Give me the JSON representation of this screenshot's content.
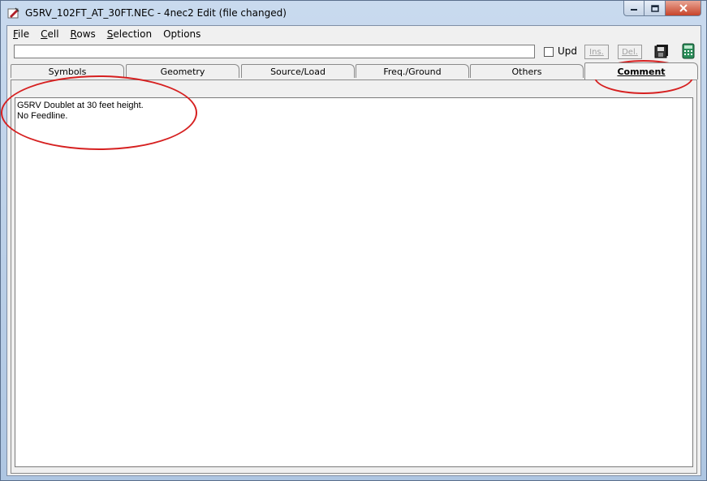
{
  "window": {
    "title": "G5RV_102FT_AT_30FT.NEC - 4nec2 Edit (file changed)",
    "accent_color": "#c7442a"
  },
  "menu": [
    {
      "id": "file",
      "label": "File",
      "accel": "F",
      "rest": "ile"
    },
    {
      "id": "cell",
      "label": "Cell",
      "accel": "C",
      "rest": "ell"
    },
    {
      "id": "rows",
      "label": "Rows",
      "accel": "R",
      "rest": "ows"
    },
    {
      "id": "selection",
      "label": "Selection",
      "accel": "S",
      "rest": "election"
    },
    {
      "id": "options",
      "label": "Options",
      "accel": "",
      "rest": "Options"
    }
  ],
  "toolbar": {
    "input_value": "",
    "upd_label": "Upd",
    "ins_label": "Ins.",
    "del_label": "Del.",
    "save_icon": "save-disk-icon",
    "calc_icon": "calculator-icon"
  },
  "tabs": [
    {
      "id": "symbols",
      "label": "Symbols",
      "active": false
    },
    {
      "id": "geometry",
      "label": "Geometry",
      "active": false
    },
    {
      "id": "source-load",
      "label": "Source/Load",
      "active": false
    },
    {
      "id": "freq-ground",
      "label": "Freq./Ground",
      "active": false
    },
    {
      "id": "others",
      "label": "Others",
      "active": false
    },
    {
      "id": "comment",
      "label": "Comment",
      "active": true
    }
  ],
  "comment": {
    "lines": [
      "G5RV Doublet at 30 feet height.",
      "No Feedline."
    ]
  },
  "annotation_color": "#d62020"
}
